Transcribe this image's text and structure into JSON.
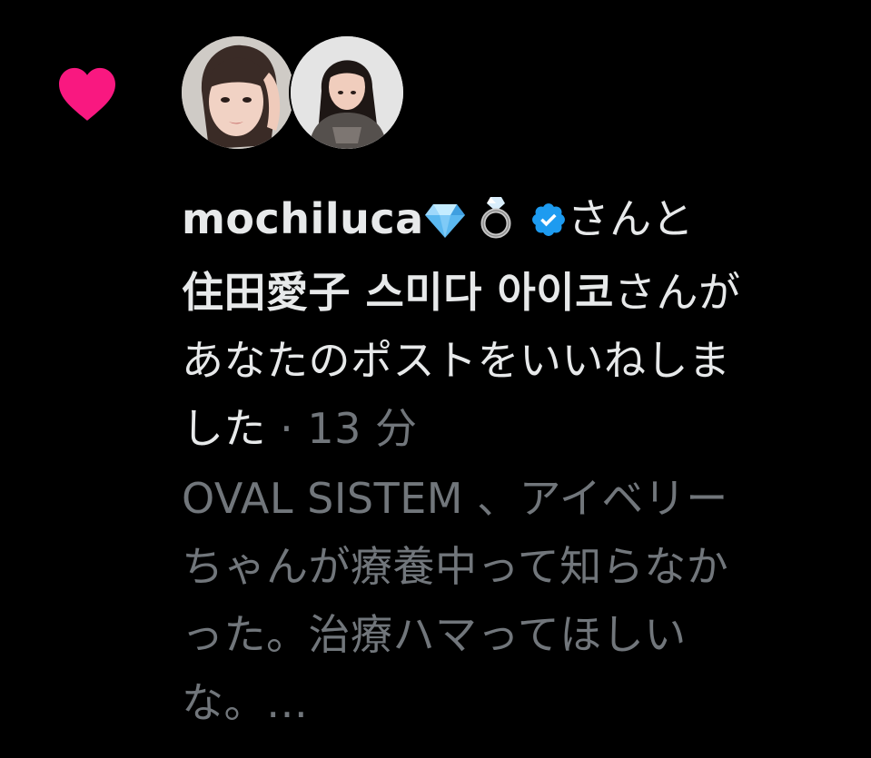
{
  "notification": {
    "type_icon": "heart-icon",
    "accent_color": "#f91880",
    "avatars": [
      {
        "name": "avatar-mochiluca"
      },
      {
        "name": "avatar-sumida-aiko"
      }
    ],
    "user1": "mochiluca",
    "user1_badges": [
      "gem-emoji",
      "ring-emoji",
      "verified-badge-icon"
    ],
    "connector": "さんと",
    "user2": "住田愛子 스미다 아이코",
    "suffix_1": "さんが",
    "action_line_1": "あなたのポストをいいねしま",
    "action_line_2": "した",
    "separator": "·",
    "timestamp": "13 分",
    "preview_lines": [
      "OVAL SISTEM 、アイベリー",
      "ちゃんが療養中って知らなか",
      "った。治療ハマってほしい",
      "な。…"
    ]
  }
}
